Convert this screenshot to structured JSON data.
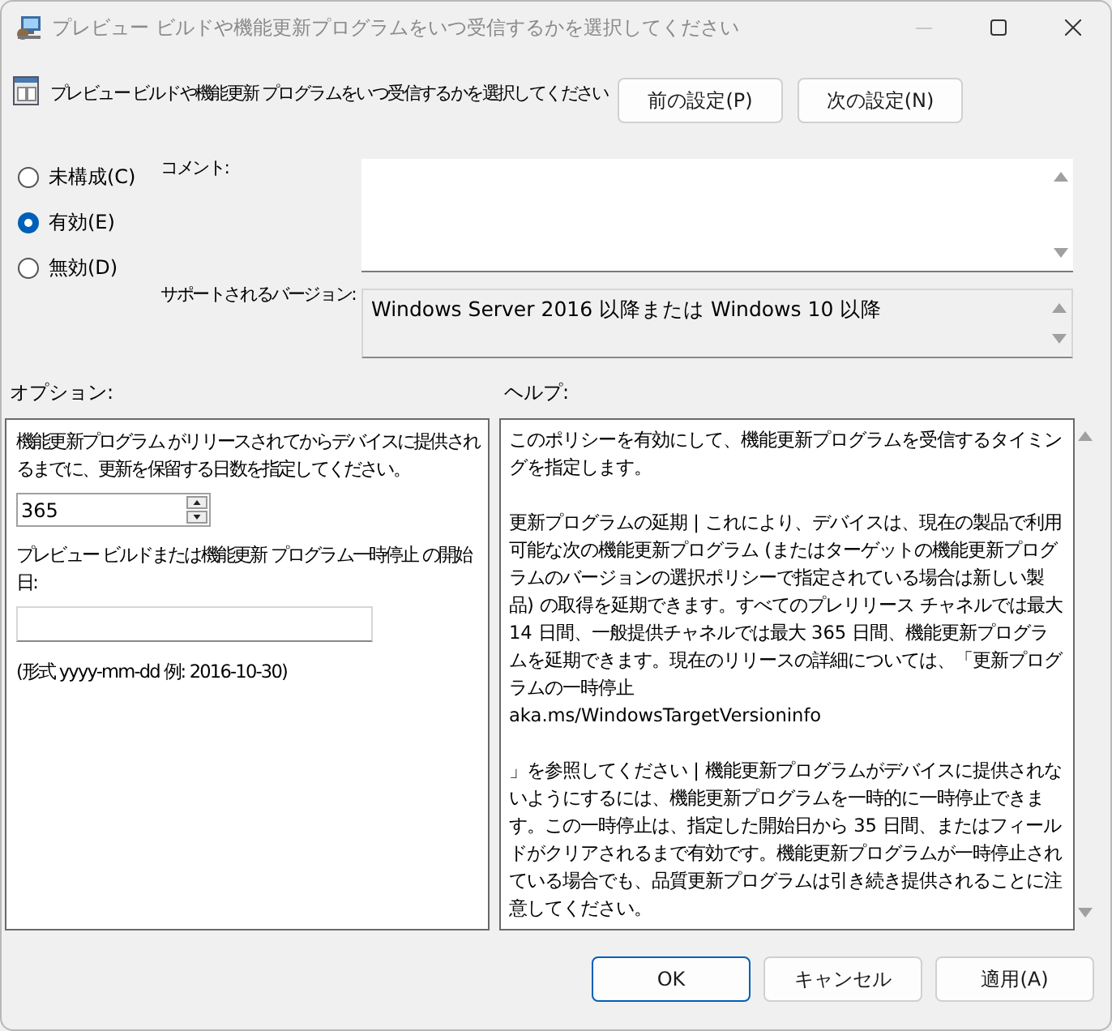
{
  "window": {
    "title": "プレビュー ビルドや機能更新プログラムをいつ受信するかを選択してください"
  },
  "header": {
    "title": "プレビュー ビルドや機能更新 プログラムをいつ受信するかを選択してください"
  },
  "nav_buttons": [
    {
      "label": "前の設定(P)"
    },
    {
      "label": "次の設定(N)"
    }
  ],
  "state_options": [
    {
      "label": "未構成(C)",
      "selected": false
    },
    {
      "label": "有効(E)",
      "selected": true
    },
    {
      "label": "無効(D)",
      "selected": false
    }
  ],
  "comment": {
    "label": "コメント:"
  },
  "supported": {
    "label": "サポートされるバージョン:",
    "value": "Windows Server 2016 以降または Windows 10 以降"
  },
  "options": {
    "label": "オプション:",
    "items": [
      {
        "kind": "text",
        "text": "機能更新プログラム がリリースされてからデバイスに提供されるまでに、更新を保留する日数を指定してください。"
      },
      {
        "kind": "spinner",
        "value": "365"
      },
      {
        "kind": "text",
        "text": "プレビュー ビルドまたは機能更新 プログラム一時停止 の開始日:"
      },
      {
        "kind": "date_field"
      },
      {
        "kind": "text",
        "text": "(形式 yyyy-mm-dd 例: 2016-10-30)"
      }
    ]
  },
  "help": {
    "label": "ヘルプ:",
    "paragraphs": [
      "このポリシーを有効にして、機能更新プログラムを受信するタイミングを指定します。",
      "更新プログラムの延期 | これにより、デバイスは、現在の製品で利用可能な次の機能更新プログラム (またはターゲットの機能更新プログラムのバージョンの選択ポリシーで指定されている場合は新しい製品) の取得を延期できます。すべてのプレリリース チャネルでは最大 14 日間、一般提供チャネルでは最大 365 日間、機能更新プログラムを延期できます。現在のリリースの詳細については、「更新プログラムの一時停止\naka.ms/WindowsTargetVersioninfo",
      "」を参照してください | 機能更新プログラムがデバイスに提供されないようにするには、機能更新プログラムを一時的に一時停止できます。この一時停止は、指定した開始日から 35 日間、またはフィールドがクリアされるまで有効です。機能更新プログラムが一時停止されている場合でも、品質更新プログラムは引き続き提供されることに注意してください。"
    ]
  },
  "buttons": [
    {
      "label": "OK",
      "default": true
    },
    {
      "label": "キャンセル",
      "default": false
    },
    {
      "label": "適用(A)",
      "default": false
    }
  ]
}
